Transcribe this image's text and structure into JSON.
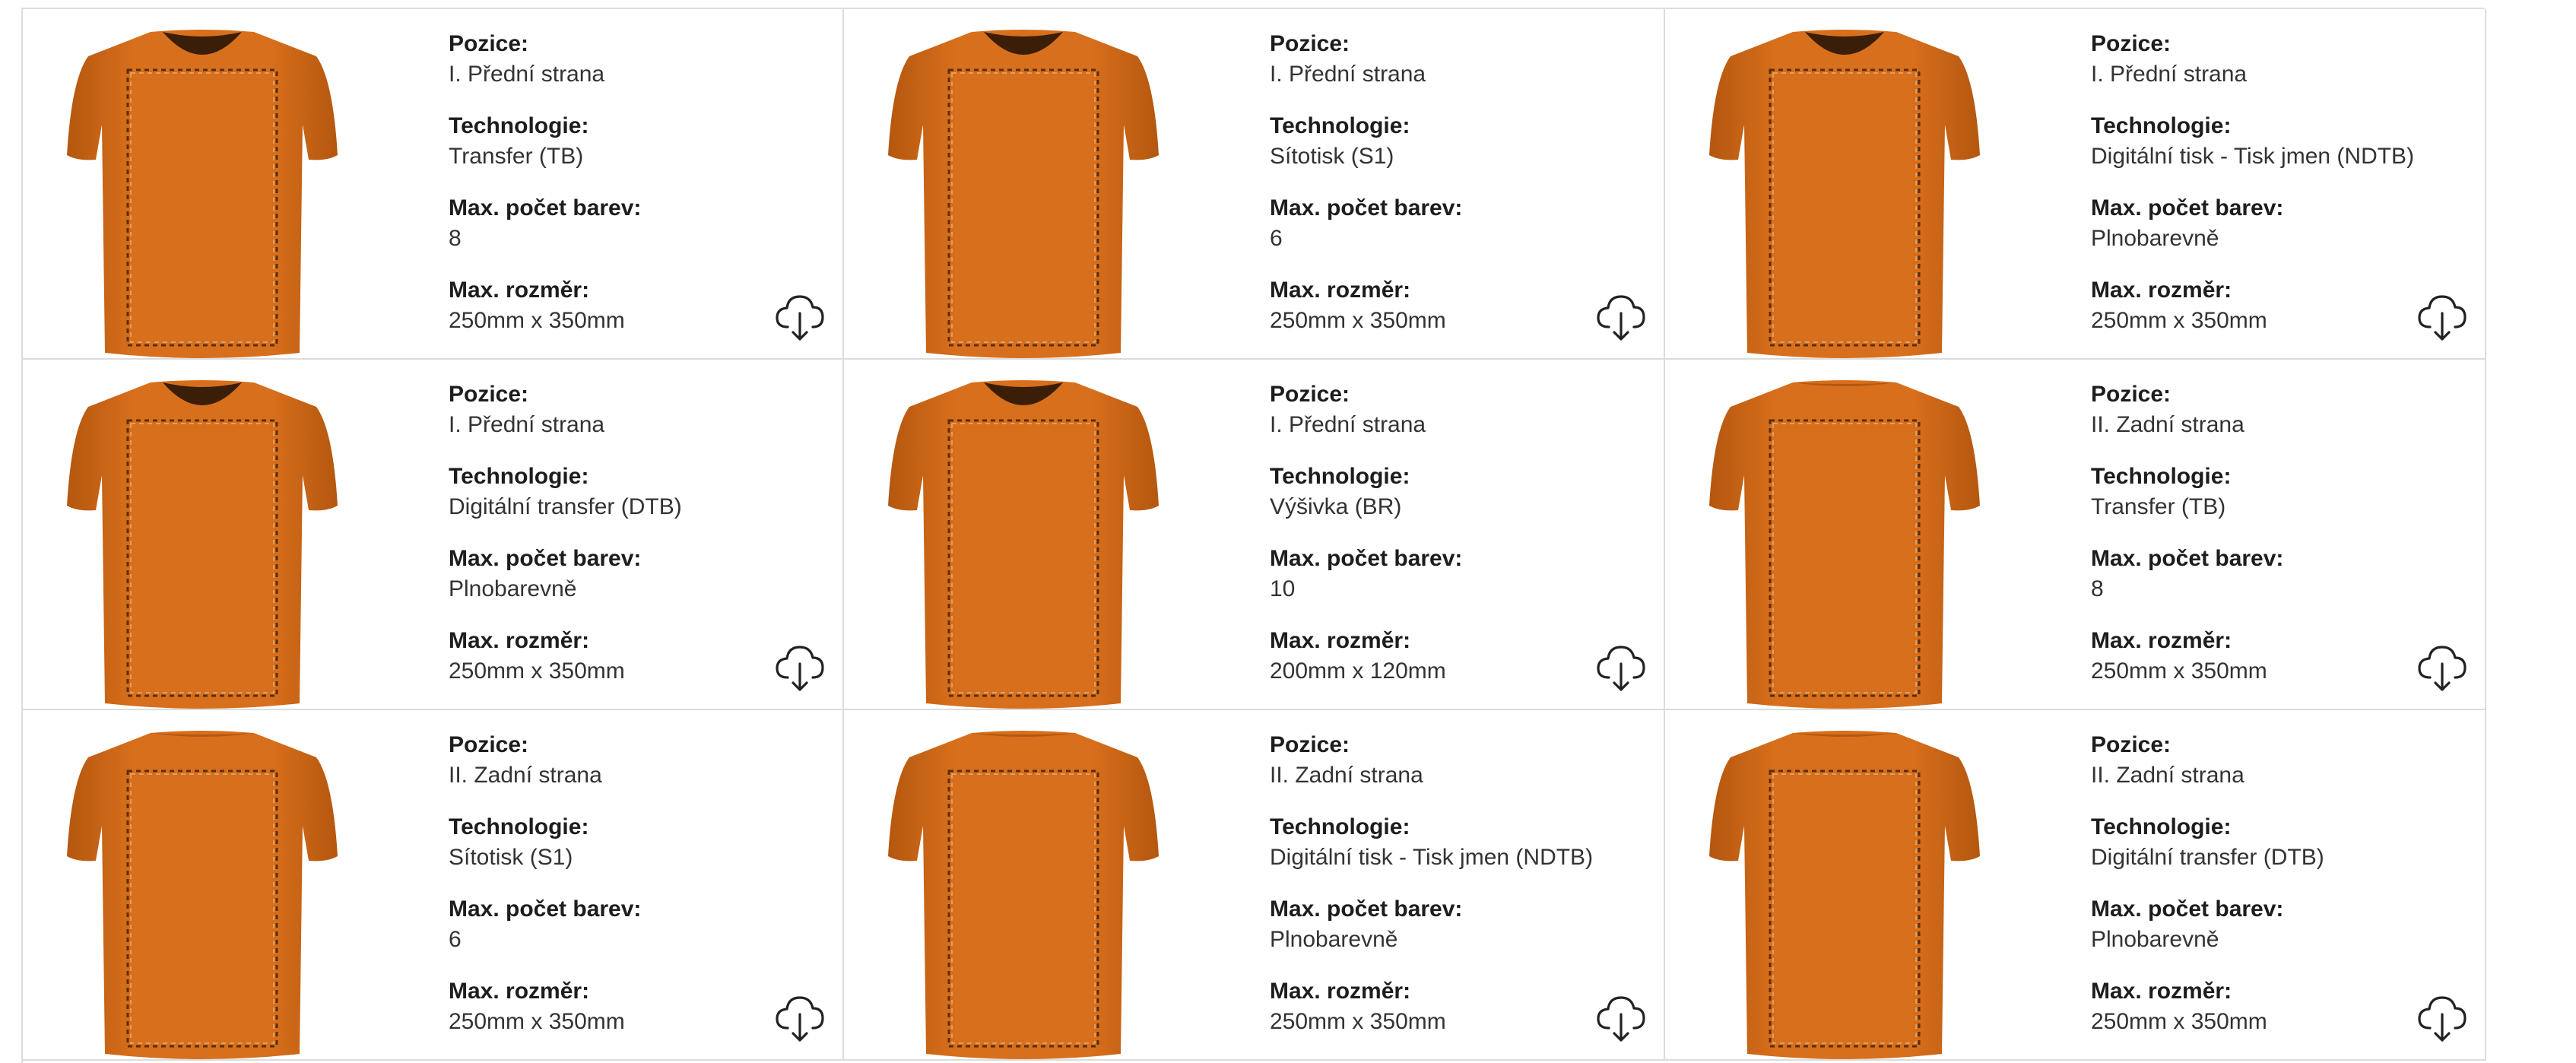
{
  "labels": {
    "position": "Pozice:",
    "technology": "Technologie:",
    "max_colors": "Max. počet barev:",
    "max_size": "Max. rozměr:"
  },
  "colors": {
    "shirt": "#d86f1c",
    "shirt_shade": "#b4570f",
    "border": "#dcdcdc"
  },
  "icons": {
    "download": "cloud-download-icon",
    "shirt_front": "tshirt-front-icon",
    "shirt_back": "tshirt-back-icon"
  },
  "items": [
    {
      "position": "I. Přední strana",
      "technology": "Transfer (TB)",
      "max_colors": "8",
      "max_size": "250mm x 350mm",
      "side": "front"
    },
    {
      "position": "I. Přední strana",
      "technology": "Sítotisk (S1)",
      "max_colors": "6",
      "max_size": "250mm x 350mm",
      "side": "front"
    },
    {
      "position": "I. Přední strana",
      "technology": "Digitální tisk - Tisk jmen (NDTB)",
      "max_colors": "Plnobarevně",
      "max_size": "250mm x 350mm",
      "side": "front"
    },
    {
      "position": "I. Přední strana",
      "technology": "Digitální transfer (DTB)",
      "max_colors": "Plnobarevně",
      "max_size": "250mm x 350mm",
      "side": "front"
    },
    {
      "position": "I. Přední strana",
      "technology": "Výšivka (BR)",
      "max_colors": "10",
      "max_size": "200mm x 120mm",
      "side": "front"
    },
    {
      "position": "II. Zadní strana",
      "technology": "Transfer (TB)",
      "max_colors": "8",
      "max_size": "250mm x 350mm",
      "side": "back"
    },
    {
      "position": "II. Zadní strana",
      "technology": "Sítotisk (S1)",
      "max_colors": "6",
      "max_size": "250mm x 350mm",
      "side": "back"
    },
    {
      "position": "II. Zadní strana",
      "technology": "Digitální tisk - Tisk jmen (NDTB)",
      "max_colors": "Plnobarevně",
      "max_size": "250mm x 350mm",
      "side": "back"
    },
    {
      "position": "II. Zadní strana",
      "technology": "Digitální transfer (DTB)",
      "max_colors": "Plnobarevně",
      "max_size": "250mm x 350mm",
      "side": "back"
    }
  ]
}
